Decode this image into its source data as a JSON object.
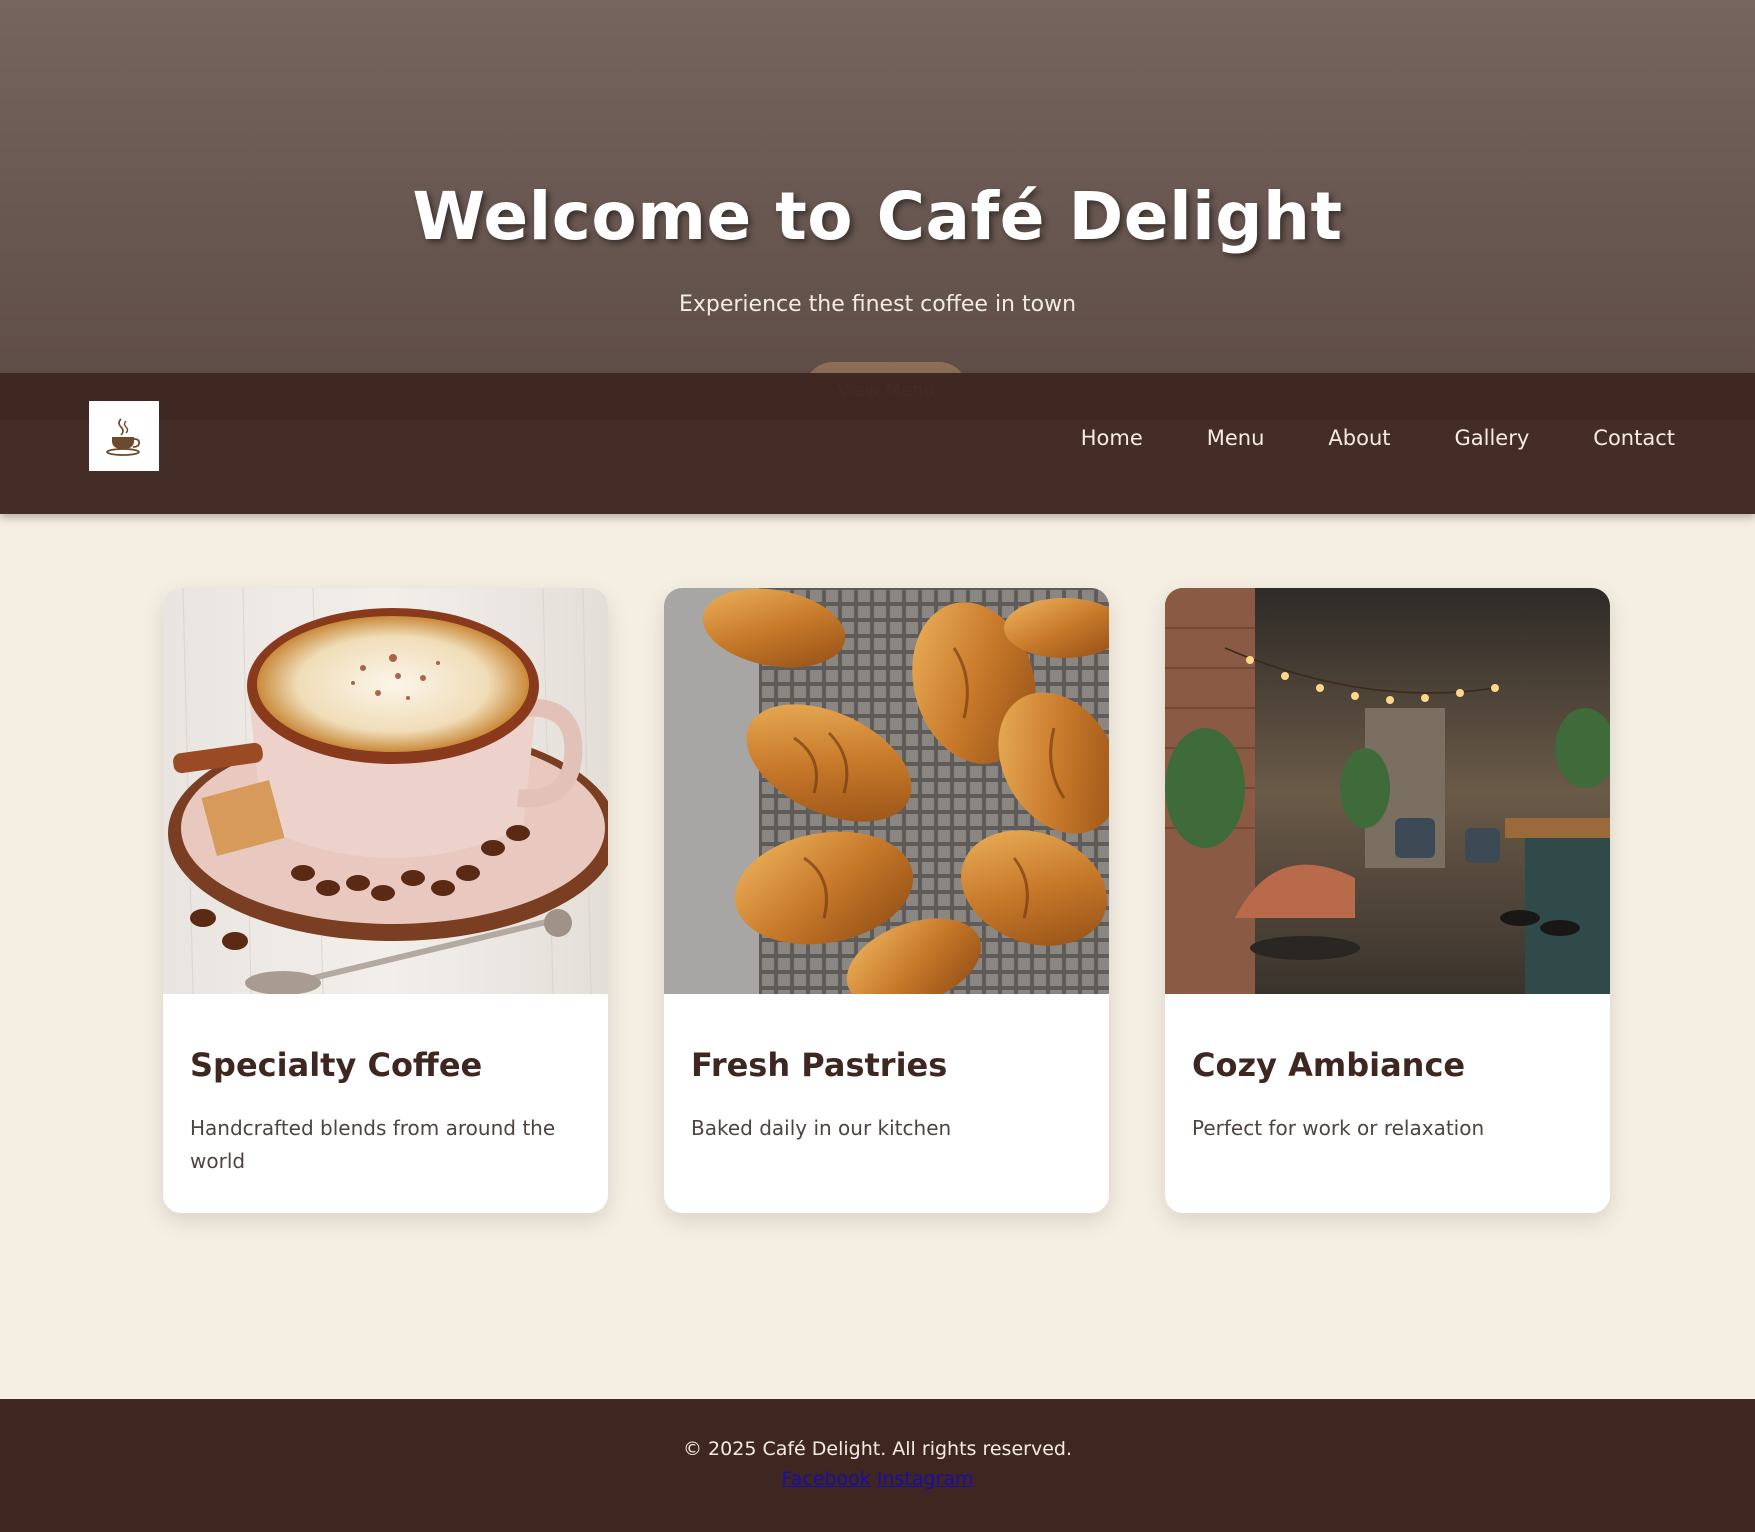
{
  "hero": {
    "title": "Welcome to Café Delight",
    "subtitle": "Experience the finest coffee in town",
    "cta_label": "View Menu"
  },
  "nav": {
    "logo_icon": "coffee-cup-icon",
    "links": [
      "Home",
      "Menu",
      "About",
      "Gallery",
      "Contact"
    ]
  },
  "features": [
    {
      "image": "cappuccino-photo",
      "title": "Specialty Coffee",
      "text": "Handcrafted blends from around the world"
    },
    {
      "image": "croissants-photo",
      "title": "Fresh Pastries",
      "text": "Baked daily in our kitchen"
    },
    {
      "image": "cafe-interior-photo",
      "title": "Cozy Ambiance",
      "text": "Perfect for work or relaxation"
    }
  ],
  "footer": {
    "copyright": "© 2025 Café Delight. All rights reserved.",
    "social": [
      "Facebook",
      "Instagram"
    ]
  },
  "colors": {
    "brand_dark": "#3e2621",
    "background": "#f5efe3",
    "accent": "#b08a63"
  }
}
